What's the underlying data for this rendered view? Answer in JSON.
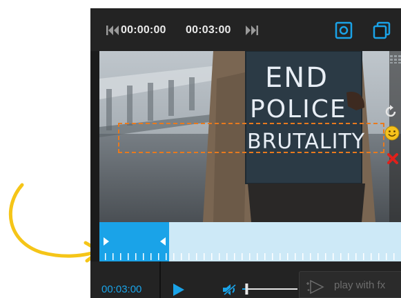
{
  "player": {
    "start_time": "00:00:00",
    "end_time": "00:03:00",
    "current_time": "00:03:00",
    "fx_button_label": "play with fx",
    "volume_level": 0.08,
    "selection_fraction": 0.23
  },
  "video": {
    "sign_lines": [
      "END",
      "POLICE",
      "BRUTALITY"
    ]
  },
  "icons": {
    "skip_back": "skip-to-start-icon",
    "skip_forward": "skip-to-end-icon",
    "snapshot": "snapshot-icon",
    "layers": "layers-icon",
    "rotate": "rotate-icon",
    "emoji": "smiley-icon",
    "delete": "close-icon",
    "play": "play-icon",
    "volume": "volume-icon",
    "fx": "fx-play-icon"
  },
  "colors": {
    "accent": "#1aa3e8",
    "selection_box": "#e87a1e",
    "annotation_arrow": "#f5c518",
    "timeline_track": "#cde9f7",
    "delete": "#e0201b",
    "emoji": "#f6c21c"
  }
}
